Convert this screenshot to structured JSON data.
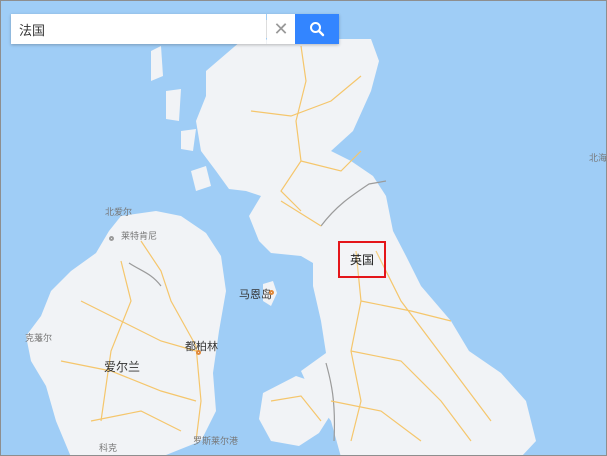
{
  "search": {
    "query": "法国",
    "clear_glyph": "✕"
  },
  "labels": {
    "uk": "英国",
    "ireland": "爱尔兰",
    "dublin": "都柏林",
    "isle_of_man": "马恩岛",
    "north_ireland_1": "北爱尔",
    "north_ireland_2": "莱特肯尼",
    "galway": "克莱尔",
    "south_1": "罗斯莱尔港",
    "south_2": "科克",
    "north_sea": "北海"
  },
  "colors": {
    "sea": "#9fcdf6",
    "land": "#f1f3f6",
    "road": "#f5c66c",
    "border": "#9b9b9b",
    "highlight": "#e4151a",
    "search_button": "#3385ff"
  }
}
